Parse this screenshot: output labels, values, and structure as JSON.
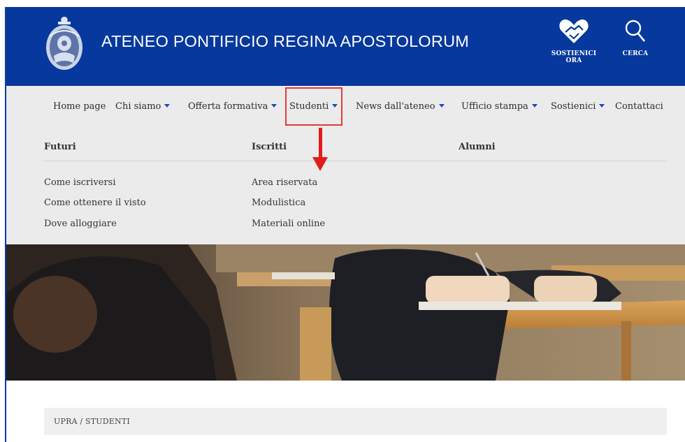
{
  "header": {
    "title": "ATENEO PONTIFICIO REGINA APOSTOLORUM",
    "support_label": "SOSTIENICI ORA",
    "search_label": "CERCA"
  },
  "nav": {
    "items": [
      {
        "label": "Home page",
        "has_dropdown": false
      },
      {
        "label": "Chi siamo",
        "has_dropdown": true
      },
      {
        "label": "Offerta formativa",
        "has_dropdown": true
      },
      {
        "label": "Studenti",
        "has_dropdown": true,
        "active": true
      },
      {
        "label": "News dall'ateneo",
        "has_dropdown": true
      },
      {
        "label": "Ufficio stampa",
        "has_dropdown": true
      },
      {
        "label": "Sostienici",
        "has_dropdown": true
      },
      {
        "label": "Contattaci",
        "has_dropdown": false
      }
    ]
  },
  "mega_menu": {
    "columns": [
      {
        "heading": "Futuri",
        "links": [
          "Come iscriversi",
          "Come ottenere il visto",
          "Dove alloggiare"
        ]
      },
      {
        "heading": "Iscritti",
        "links": [
          "Area riservata",
          "Modulistica",
          "Materiali online"
        ]
      },
      {
        "heading": "Alumni",
        "links": []
      }
    ]
  },
  "breadcrumb": {
    "text": "UPRA / STUDENTI"
  },
  "colors": {
    "header_bg": "#06389d",
    "nav_bg": "#ebebeb",
    "caret": "#1a4db3",
    "annotation": "#e21b1b"
  },
  "icons": {
    "logo": "crest-logo",
    "support": "heart-handshake-icon",
    "search": "search-icon"
  }
}
